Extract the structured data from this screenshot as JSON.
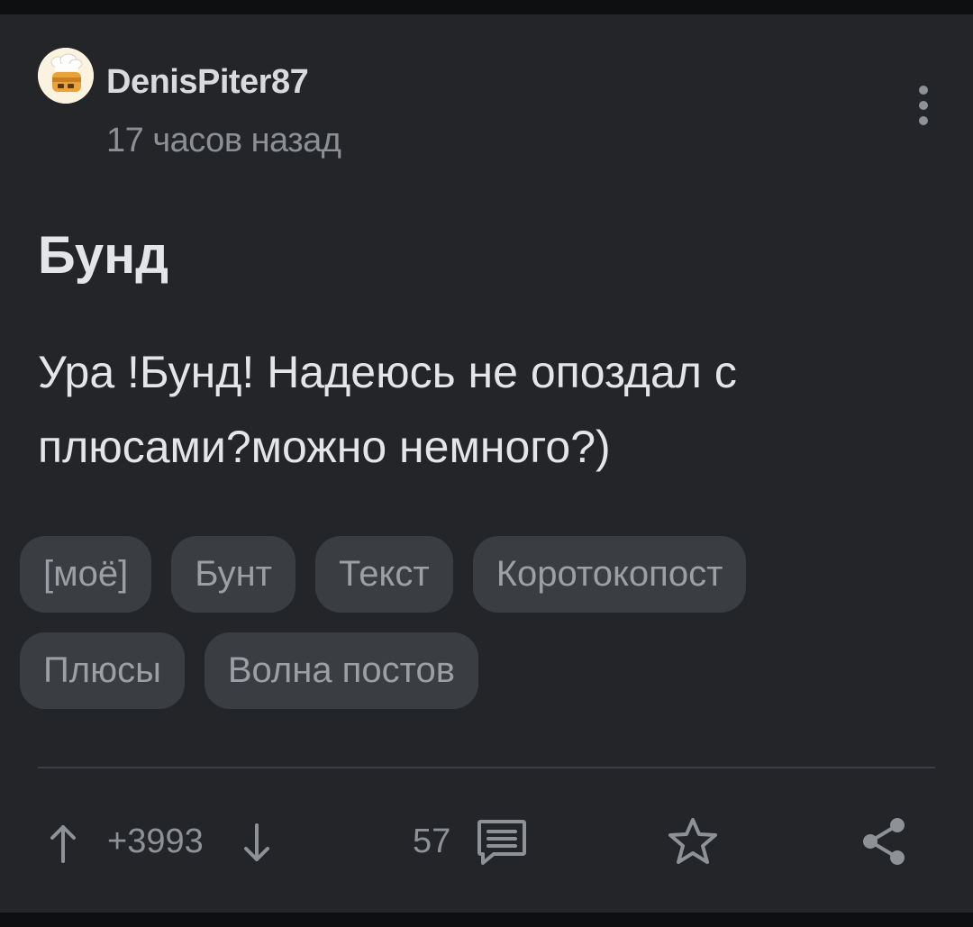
{
  "post": {
    "author": "DenisPiter87",
    "time": "17 часов назад",
    "title": "Бунд",
    "text": "Ура !Бунд! Надеюсь не опоздал с плюсами?можно немного?)",
    "tags_row1": [
      "[моё]",
      "Бунт",
      "Текст",
      "Коротокопост"
    ],
    "tags_row2": [
      "Плюсы",
      "Волна постов"
    ]
  },
  "footer": {
    "rating": "+3993",
    "comments": "57"
  },
  "icons": {
    "more": "more-vertical-icon",
    "upvote": "arrow-up-icon",
    "downvote": "arrow-down-icon",
    "comments": "comment-icon",
    "save": "star-icon",
    "share": "share-icon"
  },
  "colors": {
    "background": "#232529",
    "text": "#e3e5e7",
    "muted": "#8c8f94",
    "tag_bg": "#3a3d42"
  }
}
